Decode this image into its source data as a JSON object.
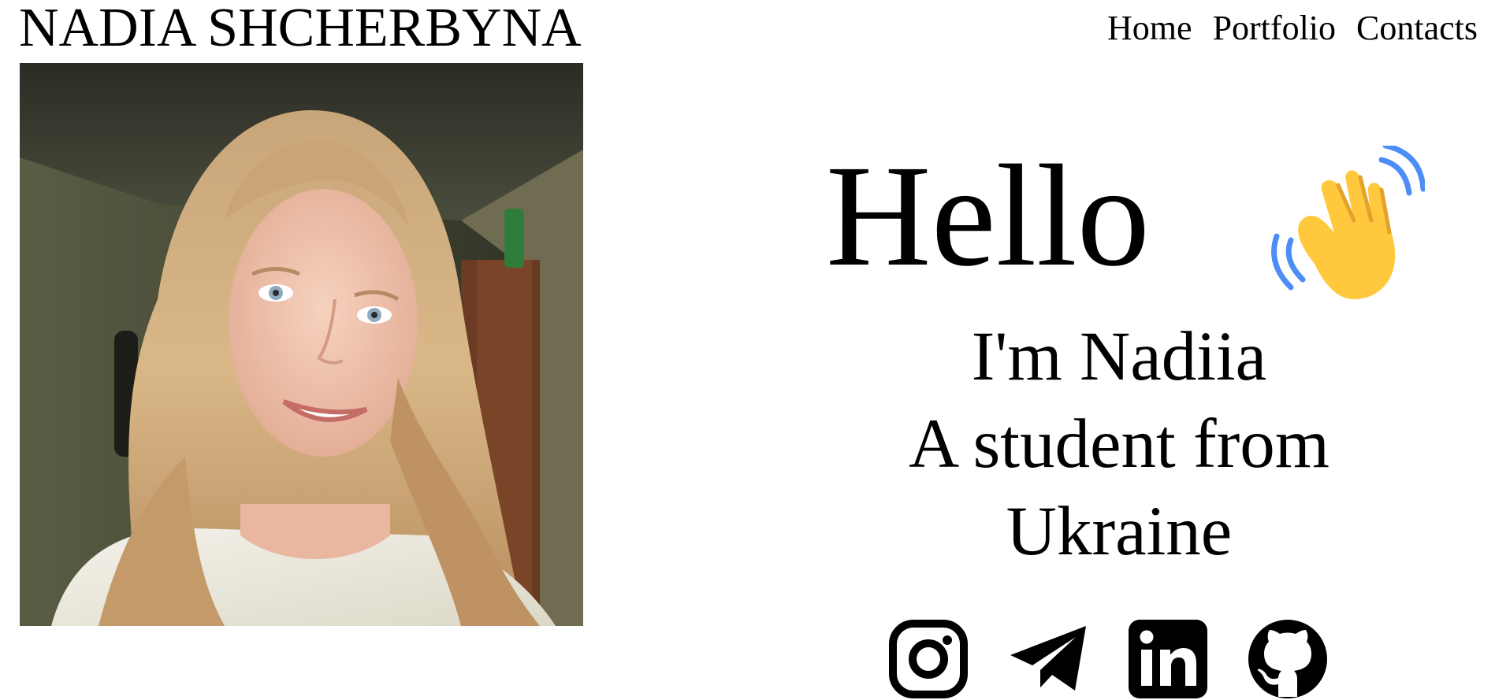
{
  "header": {
    "title": "NADIA SHCHERBYNA"
  },
  "nav": {
    "items": [
      {
        "label": "Home"
      },
      {
        "label": "Portfolio"
      },
      {
        "label": "Contacts"
      }
    ]
  },
  "profile": {
    "photo_icon": "portrait-photo"
  },
  "hero": {
    "greeting": "Hello",
    "greeting_icon": "waving-hand-emoji",
    "lines": [
      "I'm Nadiia",
      "A student from",
      "Ukraine"
    ]
  },
  "socials": [
    {
      "icon": "instagram-icon"
    },
    {
      "icon": "telegram-icon"
    },
    {
      "icon": "linkedin-icon"
    },
    {
      "icon": "github-icon"
    }
  ],
  "colors": {
    "text": "#000000",
    "background": "#ffffff",
    "wave_hand": "#FFC83D",
    "wave_lines": "#4C8DF6"
  }
}
